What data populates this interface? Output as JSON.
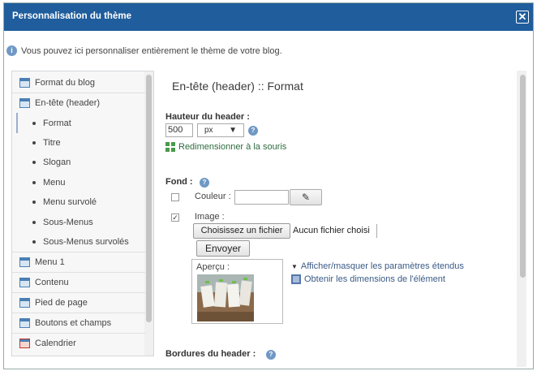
{
  "dialog": {
    "title": "Personnalisation du thème",
    "close_glyph": "✕",
    "title_bar_color": "#1f5d9c"
  },
  "info": {
    "icon": "info-icon",
    "text": "Vous pouvez ici personnaliser entièrement le thème de votre blog."
  },
  "sidebar": {
    "items": [
      {
        "label": "Format du blog",
        "type": "section",
        "icon": "layout-icon"
      },
      {
        "label": "En-tête (header)",
        "type": "section",
        "icon": "header-icon"
      },
      {
        "label": "Format",
        "type": "sub",
        "active": true
      },
      {
        "label": "Titre",
        "type": "sub"
      },
      {
        "label": "Slogan",
        "type": "sub"
      },
      {
        "label": "Menu",
        "type": "sub"
      },
      {
        "label": "Menu survolé",
        "type": "sub"
      },
      {
        "label": "Sous-Menus",
        "type": "sub"
      },
      {
        "label": "Sous-Menus survolés",
        "type": "sub"
      },
      {
        "label": "Menu 1",
        "type": "section",
        "icon": "menu-icon"
      },
      {
        "label": "Contenu",
        "type": "section",
        "icon": "content-icon"
      },
      {
        "label": "Pied de page",
        "type": "section",
        "icon": "footer-icon"
      },
      {
        "label": "Boutons et champs",
        "type": "section",
        "icon": "buttons-icon"
      },
      {
        "label": "Calendrier",
        "type": "section",
        "icon": "calendar-icon"
      }
    ]
  },
  "main": {
    "section_title": "En-tête (header) :: Format",
    "height": {
      "label": "Hauteur du header :",
      "value": "500",
      "unit": "px",
      "unit_arrow": "▼",
      "resize_link": "Redimensionner à la souris"
    },
    "background": {
      "label": "Fond :",
      "color_checked": false,
      "color_label": "Couleur :",
      "color_value": "",
      "picker_glyph": "✎",
      "image_checked": true,
      "image_label": "Image :",
      "choose_file_button": "Choisissez un fichier",
      "file_status": "Aucun fichier choisi",
      "send_button": "Envoyer",
      "preview_label": "Aperçu :",
      "toggle_extended": "Afficher/masquer les paramètres étendus",
      "get_dimensions": "Obtenir les dimensions de l'élément"
    },
    "borders": {
      "label": "Bordures du header :"
    }
  }
}
